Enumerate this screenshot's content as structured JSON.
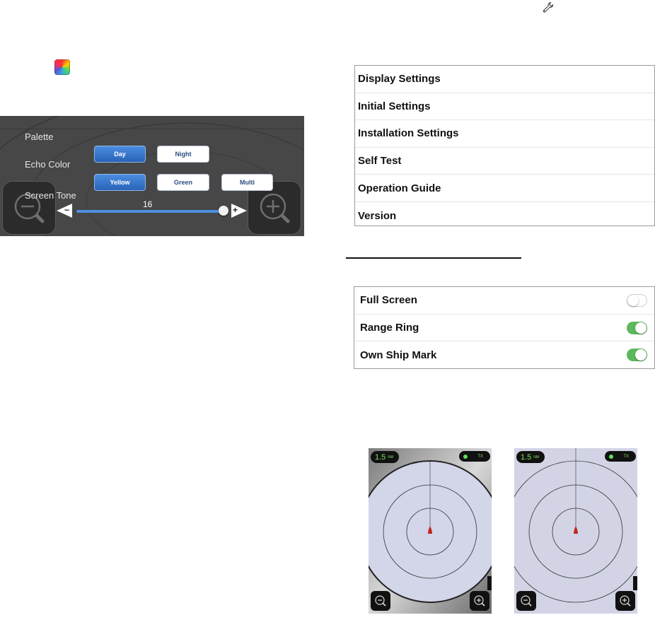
{
  "icons": {
    "wrench": "wrench-icon",
    "palette": "palette-icon"
  },
  "palette_panel": {
    "palette_label": "Palette",
    "echo_color_label": "Echo Color",
    "screen_tone_label": "Screen Tone",
    "palette_options": [
      {
        "label": "Day",
        "selected": true
      },
      {
        "label": "Night",
        "selected": false
      }
    ],
    "echo_options": [
      {
        "label": "Yellow",
        "selected": true
      },
      {
        "label": "Green",
        "selected": false
      },
      {
        "label": "Multi",
        "selected": false
      }
    ],
    "screen_tone": {
      "value": "16",
      "minus": "−",
      "plus": "+",
      "level_fraction": 0.96
    }
  },
  "menu": {
    "items": [
      {
        "label": "Display Settings"
      },
      {
        "label": "Initial Settings"
      },
      {
        "label": "Installation Settings"
      },
      {
        "label": "Self Test"
      },
      {
        "label": "Operation Guide"
      },
      {
        "label": "Version"
      }
    ]
  },
  "display_toggles": {
    "items": [
      {
        "label": "Full Screen",
        "on": false
      },
      {
        "label": "Range Ring",
        "on": true
      },
      {
        "label": "Own Ship Mark",
        "on": true
      }
    ]
  },
  "radar_left": {
    "range": "1.5",
    "unit": "NM",
    "tx": "TX"
  },
  "radar_right": {
    "range": "1.5",
    "unit": "NM",
    "tx": "TX"
  },
  "colors": {
    "accent_blue": "#2a62b8",
    "toggle_green": "#5cb85c",
    "echo_green": "#7ee35b",
    "ship_red": "#c0261d",
    "radar_bg": "#d2d4e6"
  }
}
